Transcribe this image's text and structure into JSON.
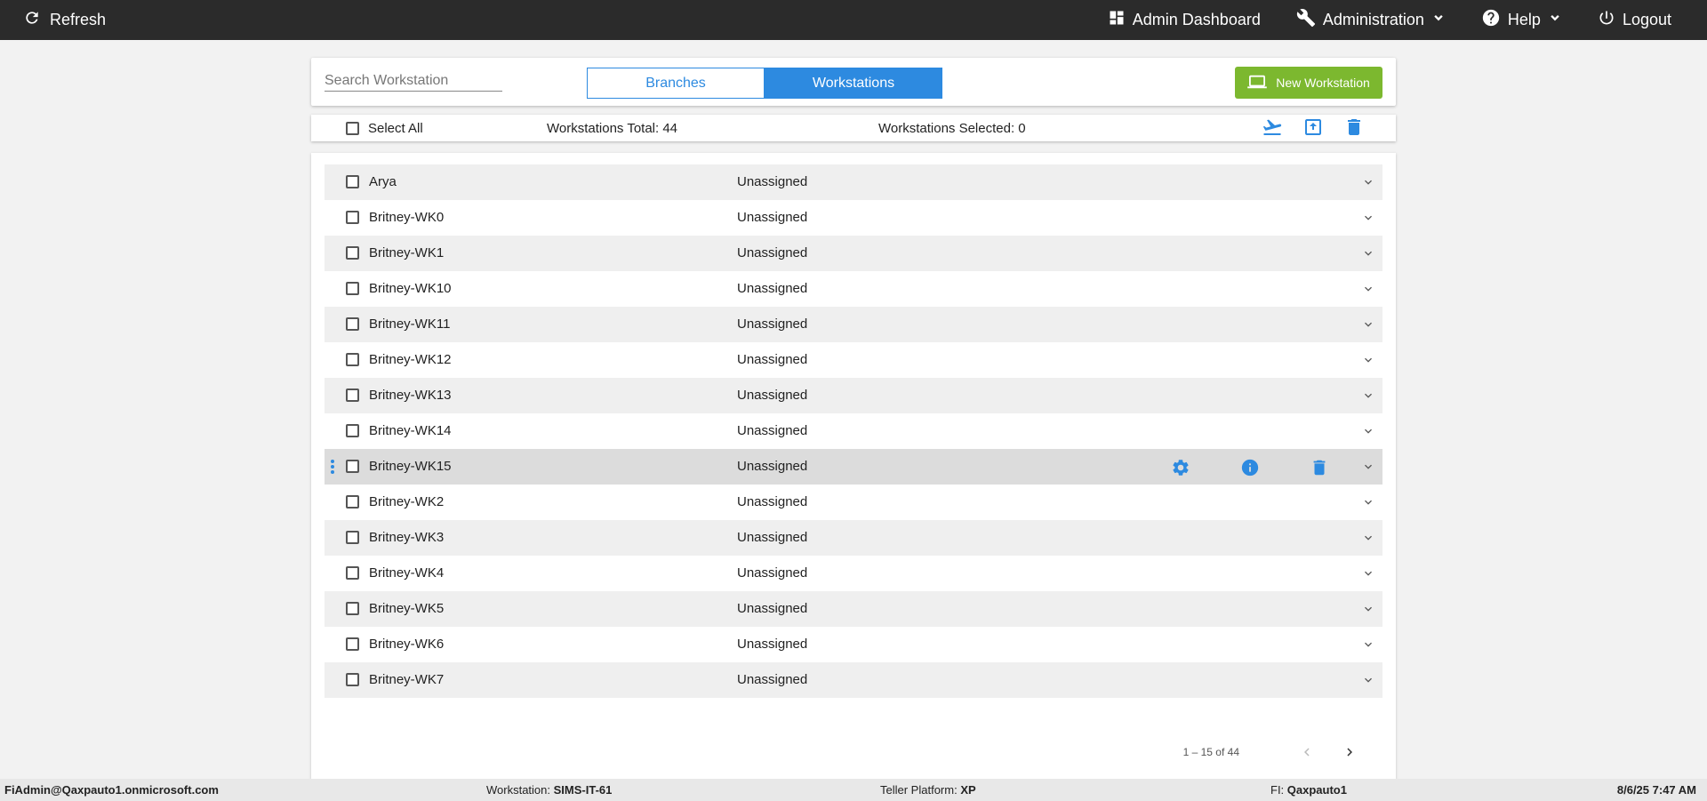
{
  "topbar": {
    "refresh_label": "Refresh",
    "nav": {
      "admin_dashboard": "Admin Dashboard",
      "administration": "Administration",
      "help": "Help",
      "logout": "Logout"
    }
  },
  "search": {
    "placeholder": "Search Workstation",
    "value": ""
  },
  "tabs": {
    "branches": "Branches",
    "workstations": "Workstations",
    "active": "Workstations"
  },
  "new_button": {
    "label": "New Workstation"
  },
  "toolbar": {
    "select_all": "Select All",
    "total": "Workstations Total: 44",
    "selected": "Workstations Selected: 0"
  },
  "rows": [
    {
      "name": "Arya",
      "status": "Unassigned"
    },
    {
      "name": "Britney-WK0",
      "status": "Unassigned"
    },
    {
      "name": "Britney-WK1",
      "status": "Unassigned"
    },
    {
      "name": "Britney-WK10",
      "status": "Unassigned"
    },
    {
      "name": "Britney-WK11",
      "status": "Unassigned"
    },
    {
      "name": "Britney-WK12",
      "status": "Unassigned"
    },
    {
      "name": "Britney-WK13",
      "status": "Unassigned"
    },
    {
      "name": "Britney-WK14",
      "status": "Unassigned"
    },
    {
      "name": "Britney-WK15",
      "status": "Unassigned"
    },
    {
      "name": "Britney-WK2",
      "status": "Unassigned"
    },
    {
      "name": "Britney-WK3",
      "status": "Unassigned"
    },
    {
      "name": "Britney-WK4",
      "status": "Unassigned"
    },
    {
      "name": "Britney-WK5",
      "status": "Unassigned"
    },
    {
      "name": "Britney-WK6",
      "status": "Unassigned"
    },
    {
      "name": "Britney-WK7",
      "status": "Unassigned"
    }
  ],
  "pager": {
    "range": "1 – 15 of 44"
  },
  "footer": {
    "user": "FiAdmin@Qaxpauto1.onmicrosoft.com",
    "workstation_label": "Workstation:",
    "workstation_value": "SIMS-IT-61",
    "platform_label": "Teller Platform:",
    "platform_value": "XP",
    "fi_label": "FI:",
    "fi_value": "Qaxpauto1",
    "datetime": "8/6/25 7:47 AM"
  },
  "colors": {
    "accent": "#2d8ae0",
    "new_button": "#7cb82f",
    "topbar": "#2b2b2b"
  }
}
